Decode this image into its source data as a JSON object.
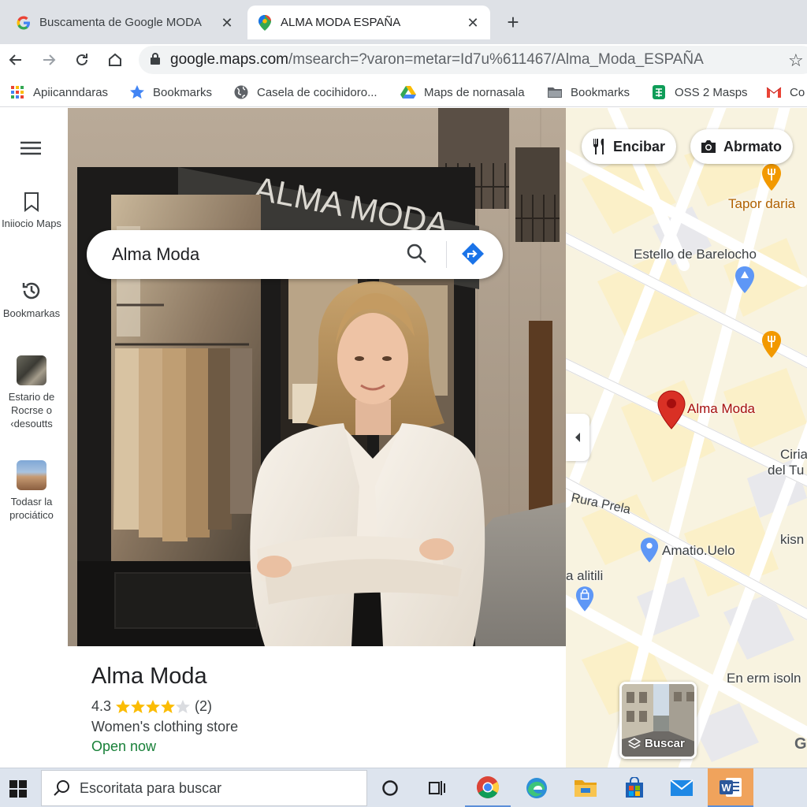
{
  "browser": {
    "tabs": [
      {
        "title": "Buscamenta de Google MODA",
        "favicon": "google-g-icon",
        "active": false,
        "close": "✕"
      },
      {
        "title": "ALMA MODA ESPAÑA",
        "favicon": "google-maps-pin-icon",
        "active": true,
        "close": "✕"
      }
    ],
    "new_tab": "+",
    "url_host": "google.maps.com",
    "url_path": "/msearch=?varon=metar=Id7u%611467/Alma_Moda_ESPAÑA",
    "bookmarks": [
      {
        "label": "Apiicanndaras",
        "icon": "apps-grid-icon"
      },
      {
        "label": "Bookmarks",
        "icon": "star-icon"
      },
      {
        "label": "Casela de cocihidoro...",
        "icon": "globe-icon"
      },
      {
        "label": "Maps de nornasala",
        "icon": "drive-icon"
      },
      {
        "label": "Bookmarks",
        "icon": "folder-icon"
      },
      {
        "label": "OSS 2 Masps",
        "icon": "sheets-icon"
      },
      {
        "label": "Co",
        "icon": "gmail-icon"
      }
    ]
  },
  "rail": {
    "items": [
      {
        "label": "Iniiocio Maps",
        "icon": "bookmark-icon"
      },
      {
        "label": "Bookmarkas",
        "icon": "history-icon"
      },
      {
        "label": "Estario de Rocrse o ‹desoutts",
        "icon": "thumbnail-1"
      },
      {
        "label": "Todasr la prociático",
        "icon": "thumbnail-2"
      }
    ]
  },
  "search": {
    "query": "Alma Moda"
  },
  "photo": {
    "sign_text": "ALMA MODA"
  },
  "place": {
    "name": "Alma Moda",
    "rating": "4.3",
    "stars": 4,
    "reviews": "(2)",
    "category": "Women's clothing store",
    "status": "Open now"
  },
  "map": {
    "chips": [
      {
        "label": "Encibar",
        "icon": "restaurant-icon"
      },
      {
        "label": "Abrmato",
        "icon": "camera-icon"
      }
    ],
    "labels": {
      "tapor": "Tapor daria",
      "estello": "Estello de Barelocho",
      "alma": "Alma Moda",
      "ciria": "Ciria",
      "deltu": "del Tu",
      "rura": "Rura Prela",
      "amatio": "Amatio.Uelo",
      "kism": "kisn",
      "alitili": "a alitili",
      "en_erm": "En erm isoln",
      "g": "G"
    },
    "layers_label": "Buscar"
  },
  "taskbar": {
    "search_placeholder": "Escoritata para buscar"
  },
  "colors": {
    "accent_blue": "#1a73e8",
    "open_green": "#188038",
    "pin_red": "#d93025",
    "star_gold": "#fbbc04"
  }
}
